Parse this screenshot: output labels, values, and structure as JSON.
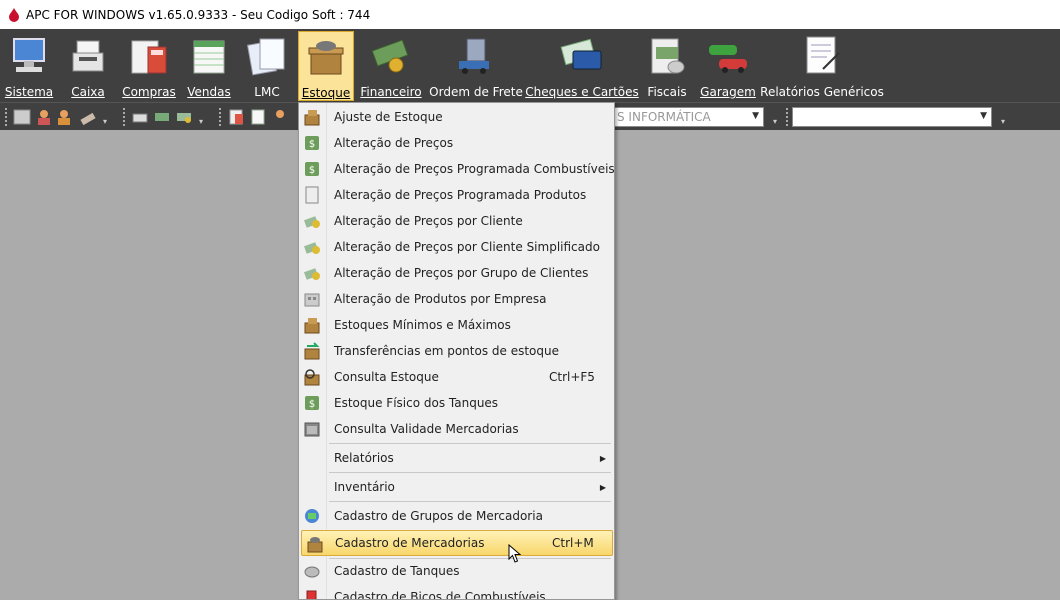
{
  "window": {
    "title": "APC FOR WINDOWS v1.65.0.9333 - Seu Codigo Soft : 744"
  },
  "ribbon": {
    "items": [
      {
        "label": "Sistema",
        "icon": "computer-icon"
      },
      {
        "label": "Caixa",
        "icon": "cash-register-icon"
      },
      {
        "label": "Compras",
        "icon": "calculator-icon"
      },
      {
        "label": "Vendas",
        "icon": "spreadsheet-icon"
      },
      {
        "label": "LMC",
        "icon": "documents-icon"
      },
      {
        "label": "Estoque",
        "icon": "box-icon"
      },
      {
        "label": "Financeiro",
        "icon": "money-icon"
      },
      {
        "label": "Ordem de Frete",
        "icon": "truck-icon"
      },
      {
        "label": "Cheques e Cartões",
        "icon": "card-icon"
      },
      {
        "label": "Fiscais",
        "icon": "fiscal-icon"
      },
      {
        "label": "Garagem",
        "icon": "cars-icon"
      },
      {
        "label": "Relatórios Genéricos",
        "icon": "report-icon"
      }
    ]
  },
  "toolbar2": {
    "company_combo": "S INFORMÁTICA",
    "search_combo": ""
  },
  "menu": {
    "items": [
      {
        "label": "Ajuste de Estoque",
        "shortcut": "",
        "icon": "boxes-icon"
      },
      {
        "label": "Alteração de Preços",
        "shortcut": "",
        "icon": "price-icon"
      },
      {
        "label": "Alteração de Preços Programada Combustíveis",
        "shortcut": "",
        "icon": "price-icon"
      },
      {
        "label": "Alteração de Preços Programada Produtos",
        "shortcut": "",
        "icon": "document-icon"
      },
      {
        "label": "Alteração de Preços por Cliente",
        "shortcut": "",
        "icon": "client-price-icon"
      },
      {
        "label": "Alteração de Preços por Cliente Simplificado",
        "shortcut": "",
        "icon": "client-price-icon"
      },
      {
        "label": "Alteração de Preços por Grupo de Clientes",
        "shortcut": "",
        "icon": "client-price-icon"
      },
      {
        "label": "Alteração de Produtos por Empresa",
        "shortcut": "",
        "icon": "company-icon"
      },
      {
        "label": "Estoques Mínimos e Máximos",
        "shortcut": "",
        "icon": "boxes-icon"
      },
      {
        "label": "Transferências em pontos de estoque",
        "shortcut": "",
        "icon": "transfer-icon"
      },
      {
        "label": "Consulta Estoque",
        "shortcut": "Ctrl+F5",
        "icon": "search-box-icon"
      },
      {
        "label": "Estoque Físico dos Tanques",
        "shortcut": "",
        "icon": "tank-icon"
      },
      {
        "label": "Consulta Validade Mercadorias",
        "shortcut": "",
        "icon": "calendar-icon"
      },
      {
        "label": "Relatórios",
        "shortcut": "",
        "icon": ""
      },
      {
        "label": "Inventário",
        "shortcut": "",
        "icon": ""
      },
      {
        "label": "Cadastro de Grupos de Mercadoria",
        "shortcut": "",
        "icon": "groups-icon"
      },
      {
        "label": "Cadastro de Mercadorias",
        "shortcut": "Ctrl+M",
        "icon": "box-icon"
      },
      {
        "label": "Cadastro de Tanques",
        "shortcut": "",
        "icon": "tank-icon"
      },
      {
        "label": "Cadastro de Bicos de Combustíveis",
        "shortcut": "",
        "icon": "pump-icon"
      }
    ]
  },
  "colors": {
    "ribbon_bg": "#404040",
    "workspace_bg": "#ababab",
    "highlight": "#f8d66a"
  }
}
